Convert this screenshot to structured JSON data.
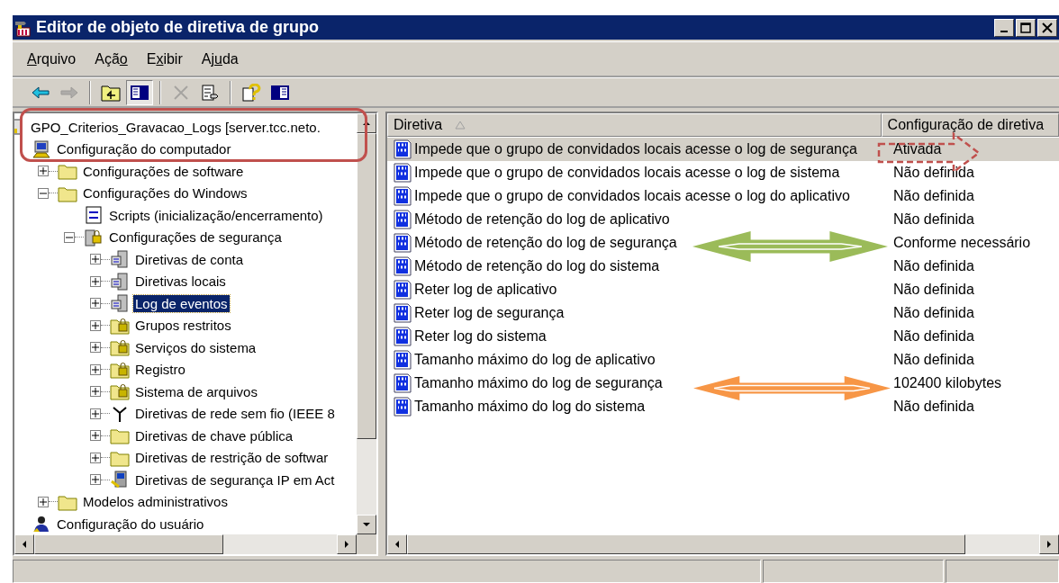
{
  "window": {
    "title": "Editor de objeto de diretiva de grupo"
  },
  "menu": [
    {
      "label": "Arquivo"
    },
    {
      "label": "Ação"
    },
    {
      "label": "Exibir"
    },
    {
      "label": "Ajuda"
    }
  ],
  "toolbar": [
    {
      "kind": "back",
      "disabled": false,
      "pressed": false
    },
    {
      "kind": "forward",
      "disabled": true,
      "pressed": false
    },
    {
      "kind": "separator"
    },
    {
      "kind": "up-folder",
      "disabled": false,
      "pressed": false
    },
    {
      "kind": "show-tree",
      "disabled": false,
      "pressed": true
    },
    {
      "kind": "separator"
    },
    {
      "kind": "delete",
      "disabled": true,
      "pressed": false
    },
    {
      "kind": "export",
      "disabled": false,
      "pressed": false
    },
    {
      "kind": "separator"
    },
    {
      "kind": "help",
      "disabled": false,
      "pressed": false
    },
    {
      "kind": "action-pane",
      "disabled": false,
      "pressed": false
    }
  ],
  "tree": [
    {
      "label": "GPO_Criterios_Gravacao_Logs [server.tcc.neto.",
      "kind": "gpo",
      "selected": false,
      "children": [
        {
          "label": "Configuração do computador",
          "kind": "computer",
          "selected": false,
          "children": [
            {
              "label": "Configurações de software",
              "kind": "folder",
              "expanded": false,
              "selected": false
            },
            {
              "label": "Configurações do Windows",
              "kind": "folder",
              "expanded": true,
              "selected": false,
              "children": [
                {
                  "label": "Scripts (inicialização/encerramento)",
                  "kind": "scripts",
                  "selected": false
                },
                {
                  "label": "Configurações de segurança",
                  "kind": "security",
                  "expanded": true,
                  "selected": false,
                  "children": [
                    {
                      "label": "Diretivas de conta",
                      "kind": "server-policy",
                      "expanded": false,
                      "selected": false
                    },
                    {
                      "label": "Diretivas locais",
                      "kind": "server-policy",
                      "expanded": false,
                      "selected": false
                    },
                    {
                      "label": "Log de eventos",
                      "kind": "server-policy",
                      "expanded": false,
                      "selected": true
                    },
                    {
                      "label": "Grupos restritos",
                      "kind": "lock-folder",
                      "expanded": false,
                      "selected": false
                    },
                    {
                      "label": "Serviços do sistema",
                      "kind": "lock-folder",
                      "expanded": false,
                      "selected": false
                    },
                    {
                      "label": "Registro",
                      "kind": "lock-folder",
                      "expanded": false,
                      "selected": false
                    },
                    {
                      "label": "Sistema de arquivos",
                      "kind": "lock-folder",
                      "expanded": false,
                      "selected": false
                    },
                    {
                      "label": "Diretivas de rede sem fio (IEEE 8",
                      "kind": "antenna",
                      "expanded": false,
                      "selected": false
                    },
                    {
                      "label": "Diretivas de chave pública",
                      "kind": "folder",
                      "expanded": false,
                      "selected": false
                    },
                    {
                      "label": "Diretivas de restrição de softwar",
                      "kind": "folder",
                      "expanded": false,
                      "selected": false
                    },
                    {
                      "label": "Diretivas de segurança IP em Act",
                      "kind": "ip-key",
                      "expanded": false,
                      "selected": false
                    }
                  ]
                }
              ]
            },
            {
              "label": "Modelos administrativos",
              "kind": "folder",
              "expanded": false,
              "selected": false
            }
          ]
        },
        {
          "label": "Configuração do usuário",
          "kind": "user",
          "selected": false
        }
      ]
    }
  ],
  "list": {
    "columns": [
      {
        "label": "Diretiva",
        "sorted": true
      },
      {
        "label": "Configuração de diretiva",
        "sorted": false
      }
    ],
    "rows": [
      {
        "name": "Impede que o grupo de convidados locais acesse o log de segurança",
        "value": "Ativada",
        "selected": true
      },
      {
        "name": "Impede que o grupo de convidados locais acesse o log de sistema",
        "value": "Não definida",
        "selected": false
      },
      {
        "name": "Impede que o grupo de convidados locais acesse o log do aplicativo",
        "value": "Não definida",
        "selected": false
      },
      {
        "name": "Método de retenção do log de aplicativo",
        "value": "Não definida",
        "selected": false
      },
      {
        "name": "Método de retenção do log de segurança",
        "value": "Conforme necessário",
        "selected": false
      },
      {
        "name": "Método de retenção do log do sistema",
        "value": "Não definida",
        "selected": false
      },
      {
        "name": "Reter log de aplicativo",
        "value": "Não definida",
        "selected": false
      },
      {
        "name": "Reter log de segurança",
        "value": "Não definida",
        "selected": false
      },
      {
        "name": "Reter log do sistema",
        "value": "Não definida",
        "selected": false
      },
      {
        "name": "Tamanho máximo do log de aplicativo",
        "value": "Não definida",
        "selected": false
      },
      {
        "name": "Tamanho máximo do log de segurança",
        "value": "102400 kilobytes",
        "selected": false
      },
      {
        "name": "Tamanho máximo do log do sistema",
        "value": "Não definida",
        "selected": false
      }
    ]
  },
  "annotations": [
    {
      "kind": "frame",
      "color": "#c0504d"
    },
    {
      "kind": "dashed-arrow",
      "color": "#c0504d"
    },
    {
      "kind": "double-arrow",
      "color": "#9bbb59"
    },
    {
      "kind": "double-arrow",
      "color": "#f79646"
    }
  ]
}
